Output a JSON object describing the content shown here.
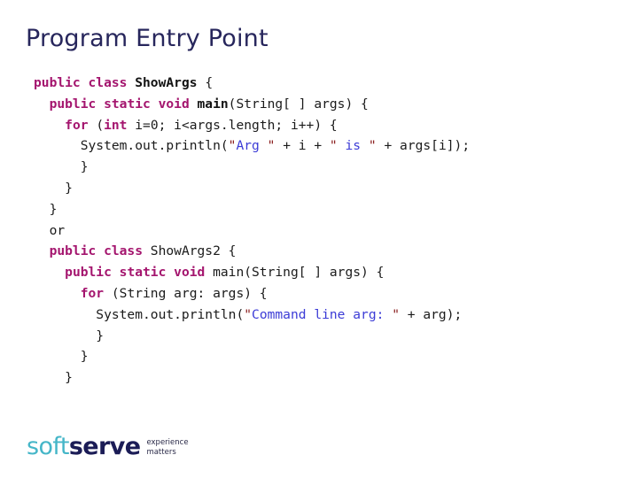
{
  "slide": {
    "title": "Program Entry Point"
  },
  "code": {
    "lines": [
      [
        {
          "t": "kw",
          "v": "public class "
        },
        {
          "t": "id",
          "v": "ShowArgs"
        },
        {
          "t": "plain",
          "v": " {"
        }
      ],
      [
        {
          "t": "plain",
          "v": "  "
        },
        {
          "t": "kw",
          "v": "public static void "
        },
        {
          "t": "id",
          "v": "main"
        },
        {
          "t": "plain",
          "v": "(String[ ] args) {"
        }
      ],
      [
        {
          "t": "plain",
          "v": "    "
        },
        {
          "t": "kw",
          "v": "for "
        },
        {
          "t": "plain",
          "v": "("
        },
        {
          "t": "kw",
          "v": "int"
        },
        {
          "t": "plain",
          "v": " i=0; i<args.length; i++) {"
        }
      ],
      [
        {
          "t": "plain",
          "v": "      System.out.println("
        },
        {
          "t": "quote",
          "v": "\""
        },
        {
          "t": "str",
          "v": "Arg "
        },
        {
          "t": "quote",
          "v": "\""
        },
        {
          "t": "plain",
          "v": " + i + "
        },
        {
          "t": "quote",
          "v": "\""
        },
        {
          "t": "str",
          "v": " is "
        },
        {
          "t": "quote",
          "v": "\""
        },
        {
          "t": "plain",
          "v": " + args[i]);"
        }
      ],
      [
        {
          "t": "plain",
          "v": "      }"
        }
      ],
      [
        {
          "t": "plain",
          "v": "    }"
        }
      ],
      [
        {
          "t": "plain",
          "v": "  }"
        }
      ],
      [
        {
          "t": "plain",
          "v": "  or"
        }
      ],
      [
        {
          "t": "kw",
          "v": "  public class "
        },
        {
          "t": "plain",
          "v": "ShowArgs2 {"
        }
      ],
      [
        {
          "t": "plain",
          "v": "    "
        },
        {
          "t": "kw",
          "v": "public static void "
        },
        {
          "t": "plain",
          "v": "main(String[ ] args) {"
        }
      ],
      [
        {
          "t": "plain",
          "v": "      "
        },
        {
          "t": "kw",
          "v": "for "
        },
        {
          "t": "plain",
          "v": "(String arg: args) {"
        }
      ],
      [
        {
          "t": "plain",
          "v": "        System.out.println("
        },
        {
          "t": "quote",
          "v": "\""
        },
        {
          "t": "str",
          "v": "Command line arg: "
        },
        {
          "t": "quote",
          "v": "\""
        },
        {
          "t": "plain",
          "v": " + arg);"
        }
      ],
      [
        {
          "t": "plain",
          "v": "        }"
        }
      ],
      [
        {
          "t": "plain",
          "v": "      }"
        }
      ],
      [
        {
          "t": "plain",
          "v": "    }"
        }
      ]
    ]
  },
  "logo": {
    "word_light": "soft",
    "word_bold": "serve",
    "tagline_line1": "experience",
    "tagline_line2": "matters"
  },
  "colors": {
    "title": "#27265c",
    "keyword": "#a4156e",
    "identifier": "#121212",
    "string": "#3b3bd6",
    "quote": "#8b2020",
    "logo_teal": "#45b6c8",
    "logo_navy": "#1b1c56",
    "background": "#ffffff"
  }
}
